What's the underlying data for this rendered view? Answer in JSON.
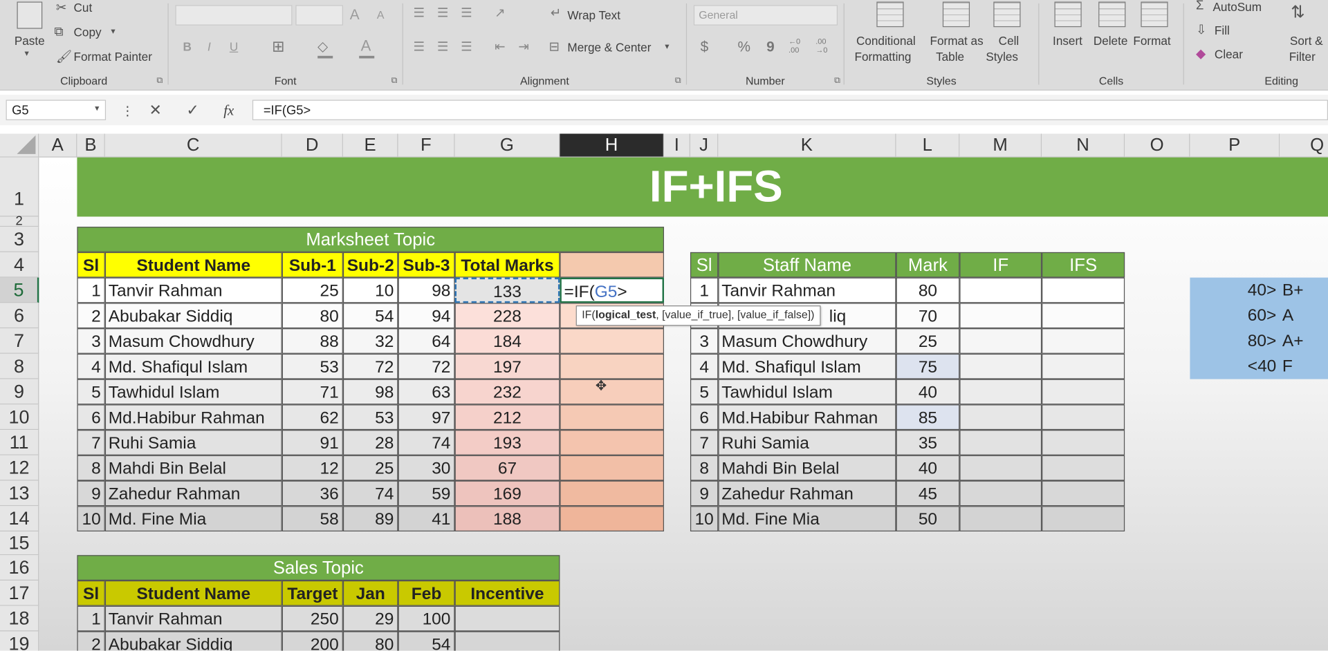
{
  "ribbon": {
    "clipboard": {
      "label": "Clipboard",
      "paste": "Paste",
      "cut": "Cut",
      "copy": "Copy",
      "format_painter": "Format Painter"
    },
    "font": {
      "label": "Font",
      "bold": "B",
      "italic": "I",
      "underline": "U",
      "font_color_glyph": "A",
      "grow": "A",
      "shrink": "A"
    },
    "alignment": {
      "label": "Alignment",
      "wrap_text": "Wrap Text",
      "merge_center": "Merge & Center"
    },
    "number": {
      "label": "Number",
      "format": "General",
      "currency": "$",
      "percent": "%",
      "comma": "9",
      "inc_decimal": "←0 .00",
      "dec_decimal": ".00 →0"
    },
    "styles": {
      "label": "Styles",
      "conditional": "Conditional",
      "conditional2": "Formatting",
      "format_table": "Format as",
      "format_table2": "Table",
      "cell_styles": "Cell",
      "cell_styles2": "Styles"
    },
    "cells": {
      "label": "Cells",
      "insert": "Insert",
      "delete": "Delete",
      "format": "Format"
    },
    "editing": {
      "label": "Editing",
      "autosum": "AutoSum",
      "fill": "Fill",
      "clear": "Clear",
      "sort": "Sort &",
      "filter": "Filter"
    }
  },
  "formula_bar": {
    "name_box": "G5",
    "formula": "=IF(G5>",
    "fx": "fx"
  },
  "columns": [
    "A",
    "B",
    "C",
    "D",
    "E",
    "F",
    "G",
    "H",
    "I",
    "J",
    "K",
    "L",
    "M",
    "N",
    "O",
    "P",
    "Q"
  ],
  "rows": [
    "1",
    "2",
    "3",
    "4",
    "5",
    "6",
    "7",
    "8",
    "9",
    "10",
    "11",
    "12",
    "13",
    "14",
    "15",
    "16",
    "17",
    "18",
    "19"
  ],
  "title": "IF+IFS",
  "marksheet": {
    "title": "Marksheet Topic",
    "headers": [
      "Sl",
      "Student Name",
      "Sub-1",
      "Sub-2",
      "Sub-3",
      "Total Marks",
      ""
    ],
    "active_formula": "=IF(",
    "active_ref": "G5",
    "active_op": ">",
    "rows": [
      [
        "1",
        "Tanvir Rahman",
        "25",
        "10",
        "98",
        "133"
      ],
      [
        "2",
        "Abubakar Siddiq",
        "80",
        "54",
        "94",
        "228"
      ],
      [
        "3",
        "Masum Chowdhury",
        "88",
        "32",
        "64",
        "184"
      ],
      [
        "4",
        "Md. Shafiqul Islam",
        "53",
        "72",
        "72",
        "197"
      ],
      [
        "5",
        "Tawhidul Islam",
        "71",
        "98",
        "63",
        "232"
      ],
      [
        "6",
        "Md.Habibur Rahman",
        "62",
        "53",
        "97",
        "212"
      ],
      [
        "7",
        "Ruhi Samia",
        "91",
        "28",
        "74",
        "193"
      ],
      [
        "8",
        "Mahdi Bin Belal",
        "12",
        "25",
        "30",
        "67"
      ],
      [
        "9",
        "Zahedur Rahman",
        "36",
        "74",
        "59",
        "169"
      ],
      [
        "10",
        "Md. Fine Mia",
        "58",
        "89",
        "41",
        "188"
      ]
    ]
  },
  "tooltip": {
    "prefix": "IF(",
    "bold_arg": "logical_test",
    "rest": ", [value_if_true], [value_if_false])"
  },
  "staff": {
    "headers": [
      "Sl",
      "Staff Name",
      "Mark",
      "IF",
      "IFS"
    ],
    "rows": [
      [
        "1",
        "Tanvir Rahman",
        "80"
      ],
      [
        "2",
        "liq",
        "70"
      ],
      [
        "3",
        "Masum Chowdhury",
        "25"
      ],
      [
        "4",
        "Md. Shafiqul Islam",
        "75"
      ],
      [
        "5",
        "Tawhidul Islam",
        "40"
      ],
      [
        "6",
        "Md.Habibur Rahman",
        "85"
      ],
      [
        "7",
        "Ruhi Samia",
        "35"
      ],
      [
        "8",
        "Mahdi Bin Belal",
        "40"
      ],
      [
        "9",
        "Zahedur Rahman",
        "45"
      ],
      [
        "10",
        "Md. Fine Mia",
        "50"
      ]
    ]
  },
  "grade_rules": [
    {
      "cond": "40>",
      "grade": "B+"
    },
    {
      "cond": "60>",
      "grade": "A"
    },
    {
      "cond": "80>",
      "grade": "A+"
    },
    {
      "cond": "<40",
      "grade": "F"
    }
  ],
  "sales": {
    "title": "Sales Topic",
    "headers": [
      "Sl",
      "Student Name",
      "Target",
      "Jan",
      "Feb",
      "Incentive"
    ],
    "rows": [
      [
        "1",
        "Tanvir Rahman",
        "250",
        "29",
        "100",
        ""
      ],
      [
        "2",
        "Abubakar Siddiq",
        "200",
        "80",
        "54",
        ""
      ]
    ]
  },
  "colors": {
    "green": "#70ad47",
    "yellow": "#ffff00",
    "olive_yellow": "#c9c900",
    "peach": "#f8cbad",
    "blue_box": "#9dc3e6",
    "selected_col": "#2b2b2b"
  }
}
